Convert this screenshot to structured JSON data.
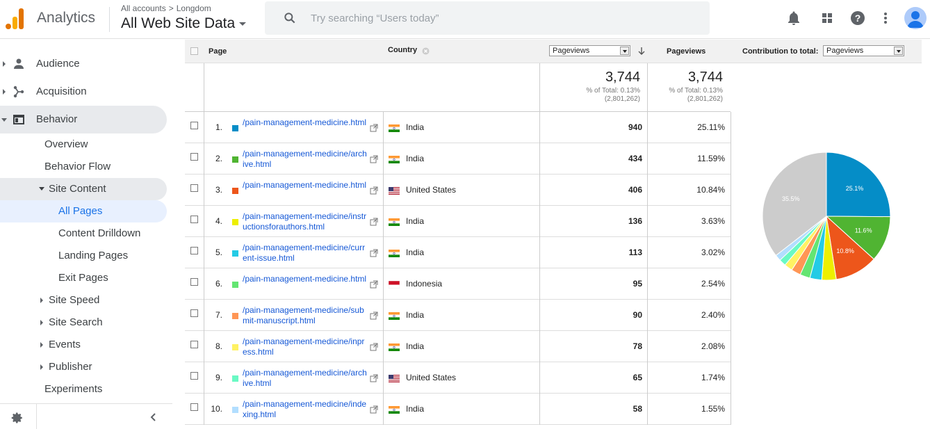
{
  "header": {
    "app_title": "Analytics",
    "breadcrumb_account": "All accounts",
    "breadcrumb_property": "Longdom",
    "view_title": "All Web Site Data",
    "search_placeholder": "Try searching “Users today”"
  },
  "sidebar": {
    "top_items": [
      {
        "label": "Audience",
        "icon": "person-icon"
      },
      {
        "label": "Acquisition",
        "icon": "acquisition-icon"
      },
      {
        "label": "Behavior",
        "icon": "behavior-icon"
      }
    ],
    "behavior_items": {
      "overview": "Overview",
      "behavior_flow": "Behavior Flow",
      "site_content": "Site Content",
      "all_pages": "All Pages",
      "content_drilldown": "Content Drilldown",
      "landing_pages": "Landing Pages",
      "exit_pages": "Exit Pages",
      "site_speed": "Site Speed",
      "site_search": "Site Search",
      "events": "Events",
      "publisher": "Publisher",
      "experiments": "Experiments"
    }
  },
  "table": {
    "col_page": "Page",
    "col_country": "Country",
    "metric_select": "Pageviews",
    "col_pageviews": "Pageviews",
    "contribution_label": "Contribution to total:",
    "contribution_select": "Pageviews",
    "totals": {
      "value_1": "3,744",
      "pct_1": "% of Total: 0.13%",
      "of_1": "(2,801,262)",
      "value_2": "3,744",
      "pct_2": "% of Total: 0.13%",
      "of_2": "(2,801,262)"
    },
    "rows": [
      {
        "idx": "1.",
        "color": "#058dc7",
        "page": "/pain-management-medicine.html",
        "country": "India",
        "flag": "india",
        "pageviews": "940",
        "pct": "25.11%"
      },
      {
        "idx": "2.",
        "color": "#50b432",
        "page": "/pain-management-medicine/archive.html",
        "country": "India",
        "flag": "india",
        "pageviews": "434",
        "pct": "11.59%"
      },
      {
        "idx": "3.",
        "color": "#ed561b",
        "page": "/pain-management-medicine.html",
        "country": "United States",
        "flag": "us",
        "pageviews": "406",
        "pct": "10.84%"
      },
      {
        "idx": "4.",
        "color": "#edef00",
        "page": "/pain-management-medicine/instructionsforauthors.html",
        "country": "India",
        "flag": "india",
        "pageviews": "136",
        "pct": "3.63%"
      },
      {
        "idx": "5.",
        "color": "#24cbe5",
        "page": "/pain-management-medicine/current-issue.html",
        "country": "India",
        "flag": "india",
        "pageviews": "113",
        "pct": "3.02%"
      },
      {
        "idx": "6.",
        "color": "#64e572",
        "page": "/pain-management-medicine.html",
        "country": "Indonesia",
        "flag": "indonesia",
        "pageviews": "95",
        "pct": "2.54%"
      },
      {
        "idx": "7.",
        "color": "#ff9655",
        "page": "/pain-management-medicine/submit-manuscript.html",
        "country": "India",
        "flag": "india",
        "pageviews": "90",
        "pct": "2.40%"
      },
      {
        "idx": "8.",
        "color": "#fff263",
        "page": "/pain-management-medicine/inpress.html",
        "country": "India",
        "flag": "india",
        "pageviews": "78",
        "pct": "2.08%"
      },
      {
        "idx": "9.",
        "color": "#6af9c4",
        "page": "/pain-management-medicine/archive.html",
        "country": "United States",
        "flag": "us",
        "pageviews": "65",
        "pct": "1.74%"
      },
      {
        "idx": "10.",
        "color": "#b2deff",
        "page": "/pain-management-medicine/indexing.html",
        "country": "India",
        "flag": "india",
        "pageviews": "58",
        "pct": "1.55%"
      }
    ]
  },
  "chart_data": {
    "type": "pie",
    "categories": [
      "1",
      "2",
      "3",
      "4",
      "5",
      "6",
      "7",
      "8",
      "9",
      "10",
      "other"
    ],
    "values": [
      25.11,
      11.59,
      10.84,
      3.63,
      3.02,
      2.54,
      2.4,
      2.08,
      1.74,
      1.55,
      35.5
    ],
    "colors": [
      "#058dc7",
      "#50b432",
      "#ed561b",
      "#edef00",
      "#24cbe5",
      "#64e572",
      "#ff9655",
      "#fff263",
      "#6af9c4",
      "#b2deff",
      "#cccccc"
    ],
    "slice_labels": [
      "25.1%",
      "11.6%",
      "10.8%",
      "",
      "",
      "",
      "",
      "",
      "",
      "",
      "35.5%"
    ]
  }
}
